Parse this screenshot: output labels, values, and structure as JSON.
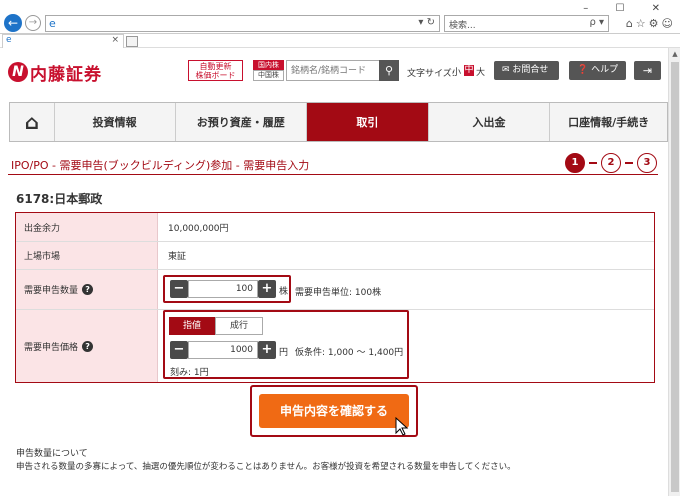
{
  "browser": {
    "search_placeholder": "検索...",
    "addr_tools": "▾ ↻",
    "search_tools": "ρ ▾",
    "window_buttons": "– ☐ ✕",
    "right_icons": "⌂☆⚙☺",
    "tab_close": "×"
  },
  "header": {
    "logo_mark": "N",
    "logo_text": "内藤証券",
    "auto_update_line1": "自動更新",
    "auto_update_line2": "株価ボード",
    "market_1": "国内株",
    "market_2": "中国株",
    "stock_placeholder": "銘柄名/銘柄コード",
    "font_size_label": "文字サイズ:",
    "font_small": "小",
    "font_mid": "中",
    "font_large": "大",
    "contact_label": "お問合せ",
    "help_label": "ヘルプ"
  },
  "nav": {
    "items": [
      "投資情報",
      "お預り資産・履歴",
      "取引",
      "入出金",
      "口座情報/手続き"
    ]
  },
  "page": {
    "title": "IPO/PO - 需要申告(ブックビルディング)参加 - 需要申告入力",
    "steps": [
      "1",
      "2",
      "3"
    ],
    "stock": "6178:日本郵政"
  },
  "form": {
    "balance_label": "出金余力",
    "balance_value": "10,000,000円",
    "market_label": "上場市場",
    "market_value": "東証",
    "qty_label": "需要申告数量",
    "qty_value": "100",
    "qty_unit": "株",
    "qty_note": "需要申告単位: 100株",
    "price_label": "需要申告価格",
    "price_limit": "指値",
    "price_market": "成行",
    "price_value": "1000",
    "price_unit": "円",
    "price_condition": "仮条件: 1,000 ～ 1,400円",
    "price_tick": "刻み: 1円",
    "minus": "−",
    "plus": "+",
    "help_mark": "?"
  },
  "confirm_label": "申告内容を確認する",
  "notes": {
    "head": "申告数量について",
    "body": "申告される数量の多寡によって、抽選の優先順位が変わることはありません。お客様が投資を希望される数量を申告してください。"
  },
  "colors": {
    "brand": "#c8102e",
    "nav_active": "#a30a14",
    "confirm": "#f06a14"
  }
}
